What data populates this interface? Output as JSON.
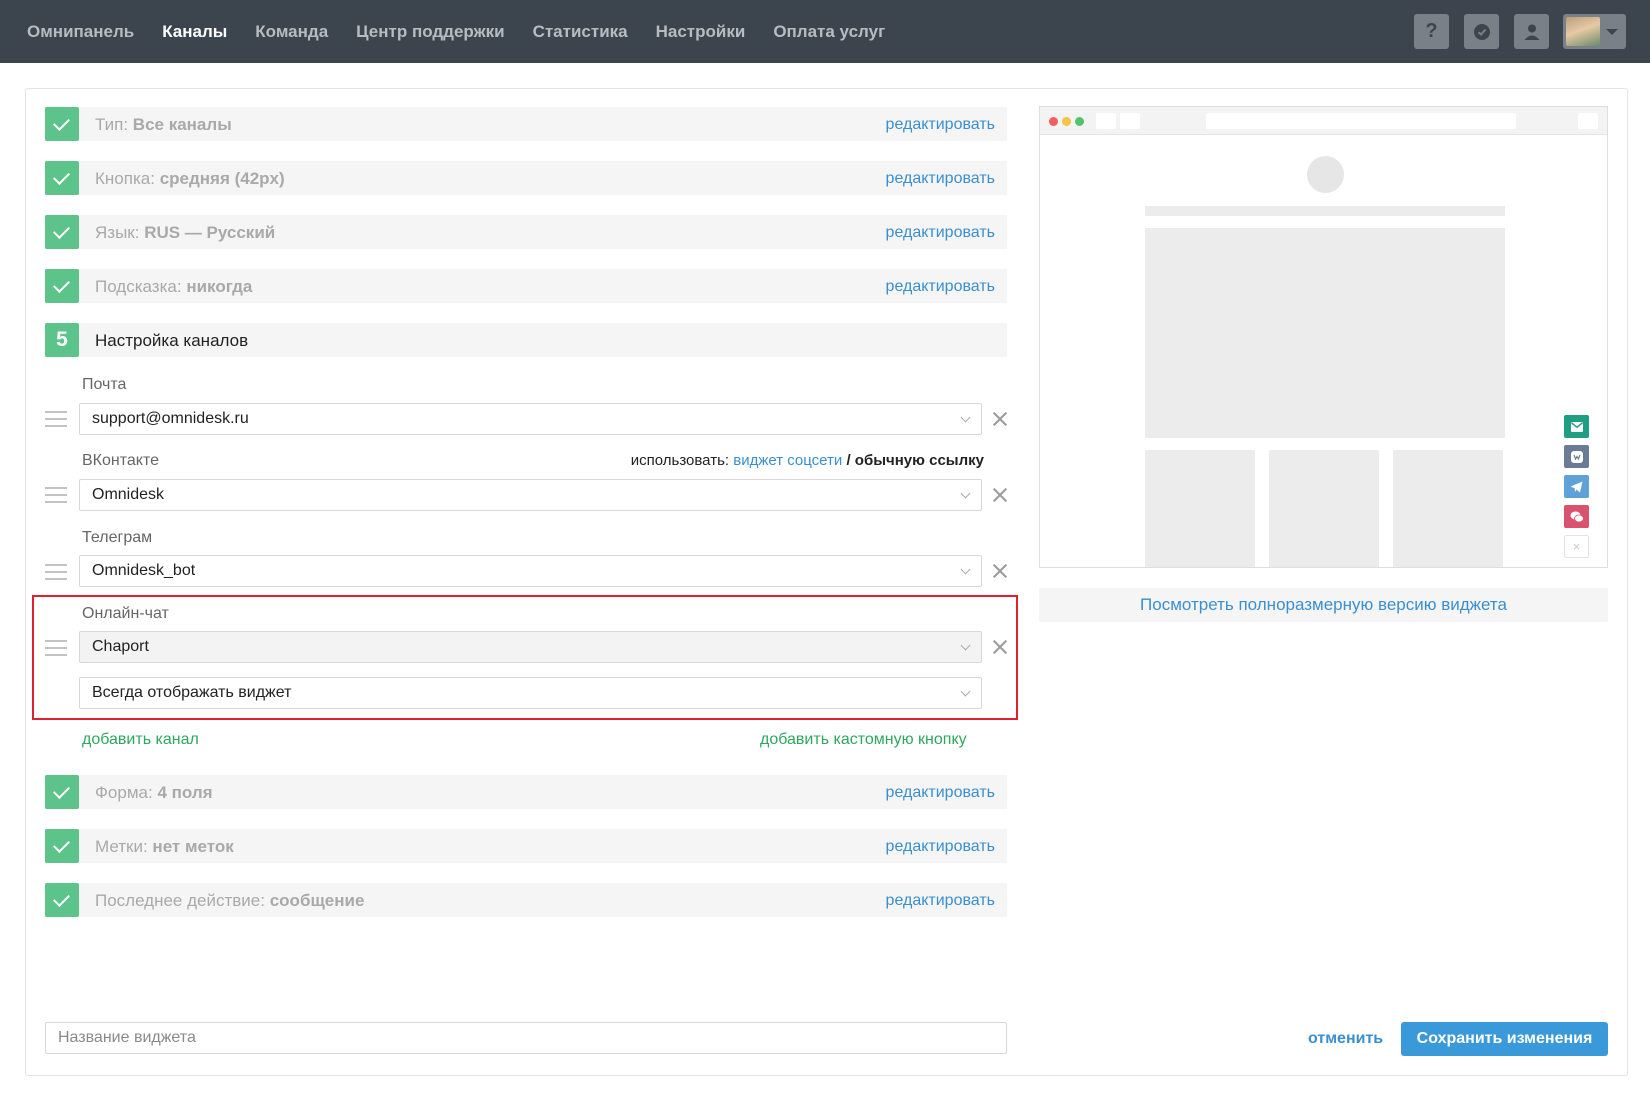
{
  "nav": {
    "items": [
      "Омнипанель",
      "Каналы",
      "Команда",
      "Центр поддержки",
      "Статистика",
      "Настройки",
      "Оплата услуг"
    ],
    "active": "Каналы",
    "help_label": "?"
  },
  "steps": [
    {
      "label": "Тип:",
      "value": "Все каналы",
      "action": "редактировать"
    },
    {
      "label": "Кнопка:",
      "value": "средняя (42px)",
      "action": "редактировать"
    },
    {
      "label": "Язык:",
      "value": "RUS — Русский",
      "action": "редактировать"
    },
    {
      "label": "Подсказка:",
      "value": "никогда",
      "action": "редактировать"
    }
  ],
  "step5": {
    "number": "5",
    "title": "Настройка каналов"
  },
  "channels": {
    "mail": {
      "label": "Почта",
      "value": "support@omnidesk.ru"
    },
    "vk": {
      "label": "ВКонтакте",
      "value": "Omnidesk",
      "use_prefix": "использовать:",
      "use_widget": "виджет соцсети",
      "use_sep": "/",
      "use_link": "обычную ссылку"
    },
    "telegram": {
      "label": "Телеграм",
      "value": "Omnidesk_bot"
    },
    "chat": {
      "label": "Онлайн-чат",
      "value": "Chaport",
      "display_mode": "Всегда отображать виджет"
    }
  },
  "add_channel": "добавить канал",
  "add_custom_button": "добавить кастомную кнопку",
  "steps_after": [
    {
      "label": "Форма:",
      "value": "4 поля",
      "action": "редактировать"
    },
    {
      "label": "Метки:",
      "value": "нет меток",
      "action": "редактировать"
    },
    {
      "label": "Последнее действие:",
      "value": "сообщение",
      "action": "редактировать"
    }
  ],
  "widget_name": {
    "placeholder": "Название виджета",
    "value": ""
  },
  "cancel": "отменить",
  "save": "Сохранить изменения",
  "preview": {
    "full_link": "Посмотреть полноразмерную версию виджета",
    "close_glyph": "×",
    "widget_buttons": [
      {
        "icon": "mail-icon",
        "color": "#1f9e83"
      },
      {
        "icon": "vk-icon",
        "color": "#6c7b95"
      },
      {
        "icon": "telegram-icon",
        "color": "#5fa1d8"
      },
      {
        "icon": "chat-icon",
        "color": "#d9526e"
      }
    ]
  },
  "colors": {
    "topbar": "#3c444d",
    "accent_green": "#5cc38b",
    "link_blue": "#3a8fd0",
    "save_blue": "#3a9ad9",
    "highlight_red": "#e0202e"
  }
}
